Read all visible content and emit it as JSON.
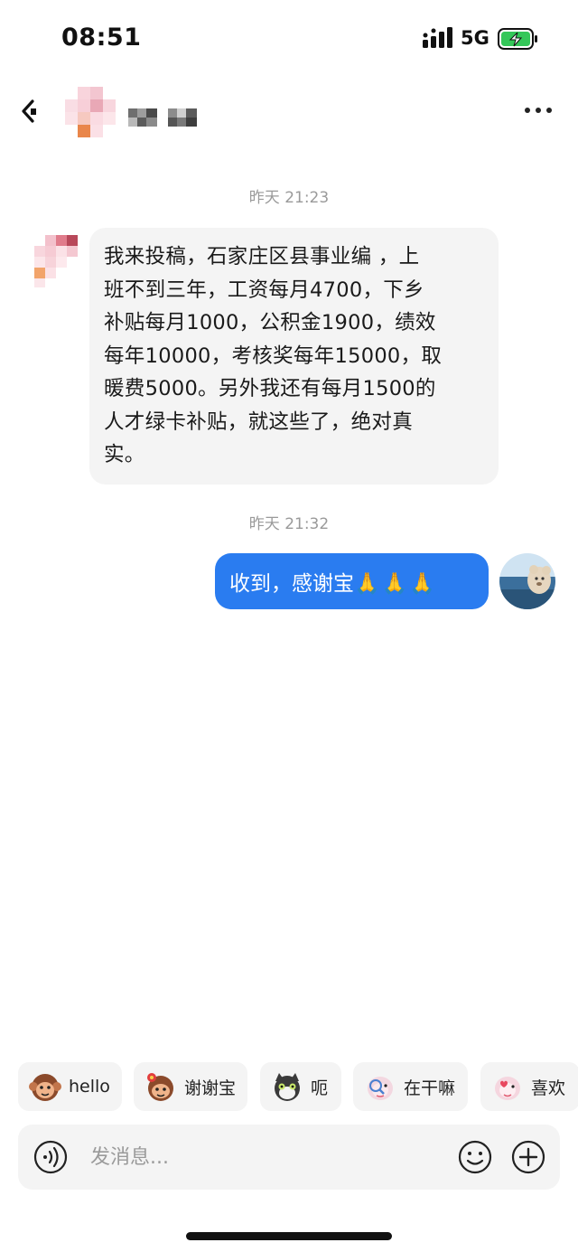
{
  "status_bar": {
    "time": "08:51",
    "network": "5G",
    "battery_icon": "battery-charging-icon",
    "battery_color": "#34c759"
  },
  "header": {
    "back_icon": "back-arrow-icon",
    "more_icon": "more-dots-icon"
  },
  "messages": [
    {
      "timestamp": "昨天 21:23",
      "direction": "incoming",
      "lines": [
        "我来投稿，石家庄区县事业编 ，上",
        "班不到三年，工资每月4700，下乡",
        "补贴每月1000，公积金1900，绩效",
        "每年10000，考核奖每年15000，取",
        "暖费5000。另外我还有每月1500的",
        "人才绿卡补贴，就这些了，绝对真",
        "实。"
      ]
    },
    {
      "timestamp": "昨天 21:32",
      "direction": "outgoing",
      "text": "收到，感谢宝",
      "emoji": "🙏🙏🙏"
    }
  ],
  "quick_replies": [
    {
      "label": "hello",
      "icon": "monkey-sticker-icon"
    },
    {
      "label": "谢谢宝",
      "icon": "monkey-flower-sticker-icon"
    },
    {
      "label": "呃",
      "icon": "cat-sticker-icon"
    },
    {
      "label": "在干嘛",
      "icon": "search-monkey-sticker-icon"
    },
    {
      "label": "喜欢",
      "icon": "love-monkey-sticker-icon"
    }
  ],
  "input": {
    "placeholder": "发消息...",
    "value": ""
  },
  "colors": {
    "outgoing_bubble": "#2a7cf0",
    "incoming_bubble": "#f4f4f4",
    "timestamp": "#9a9a9a"
  }
}
